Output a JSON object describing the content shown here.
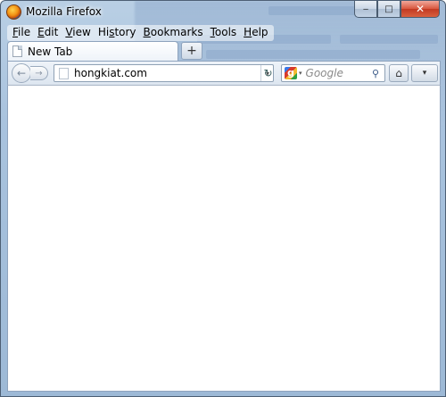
{
  "window": {
    "title": "Mozilla Firefox",
    "app_icon": "firefox-logo",
    "caption_buttons": {
      "minimize": "‒",
      "maximize": "□",
      "close": "✕"
    }
  },
  "menubar": {
    "items": [
      {
        "label_pre": "",
        "accel": "F",
        "label_post": "ile"
      },
      {
        "label_pre": "",
        "accel": "E",
        "label_post": "dit"
      },
      {
        "label_pre": "",
        "accel": "V",
        "label_post": "iew"
      },
      {
        "label_pre": "Hi",
        "accel": "s",
        "label_post": "tory"
      },
      {
        "label_pre": "",
        "accel": "B",
        "label_post": "ookmarks"
      },
      {
        "label_pre": "",
        "accel": "T",
        "label_post": "ools"
      },
      {
        "label_pre": "",
        "accel": "H",
        "label_post": "elp"
      }
    ]
  },
  "tabs": {
    "items": [
      {
        "label": "New Tab",
        "icon": "page-icon"
      }
    ],
    "new_tab_symbol": "+"
  },
  "navbar": {
    "back_symbol": "←",
    "forward_symbol": "→",
    "url": "hongkiat.com",
    "url_dropdown_symbol": "▾",
    "reload_symbol": "↻",
    "search_engine_icon": "google-icon",
    "search_engine_letter": "g",
    "search_engine_arrow": "▾",
    "search_placeholder": "Google",
    "search_symbol": "⚲",
    "home_symbol": "⌂",
    "addon_symbol": "▾"
  },
  "colors": {
    "frame": "#a9c3de",
    "close_button": "#c23a22",
    "content_background": "#ffffff"
  }
}
